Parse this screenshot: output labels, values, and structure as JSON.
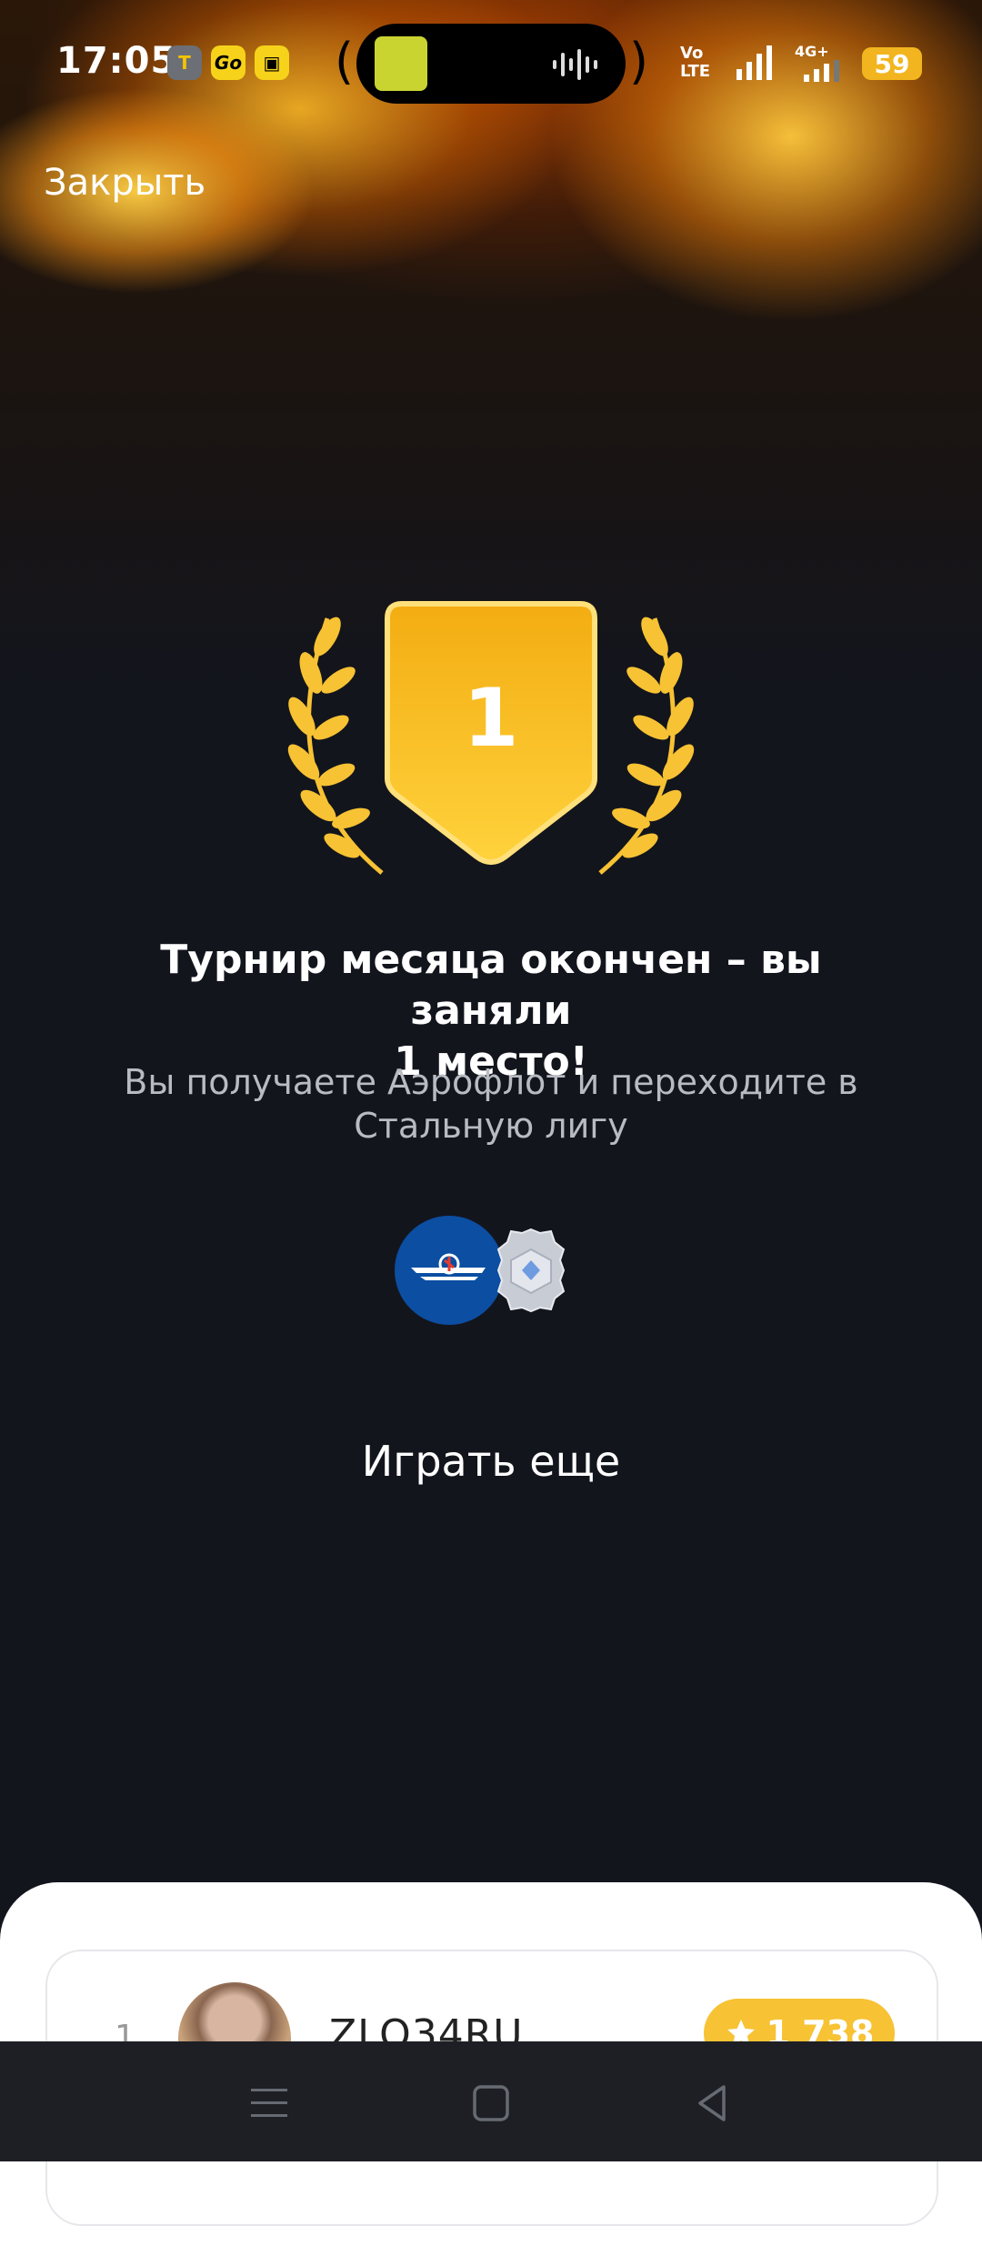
{
  "status_bar": {
    "time": "17:05",
    "app_icons": [
      "T",
      "Go",
      "taxi"
    ],
    "network_left": "Vo",
    "network_left2": "LTE",
    "network_right": "4G+",
    "battery": "59"
  },
  "header": {
    "close_label": "Закрыть"
  },
  "result": {
    "place": "1",
    "title_line1": "Турнир месяца окончен – вы заняли",
    "title_line2": "1 место!",
    "subtitle_line1": "Вы получаете Аэрофлот и переходите в",
    "subtitle_line2": "Стальную лигу"
  },
  "rewards": [
    "aeroflot-logo",
    "steel-league-badge"
  ],
  "actions": {
    "play_again_label": "Играть еще"
  },
  "leaderboard": {
    "rows": [
      {
        "rank": "1",
        "username": "ZLO34RU",
        "score": "1 738"
      }
    ]
  },
  "colors": {
    "background": "#13151d",
    "accent_gold": "#f7c233",
    "aeroflot_blue": "#0b4ea2"
  }
}
